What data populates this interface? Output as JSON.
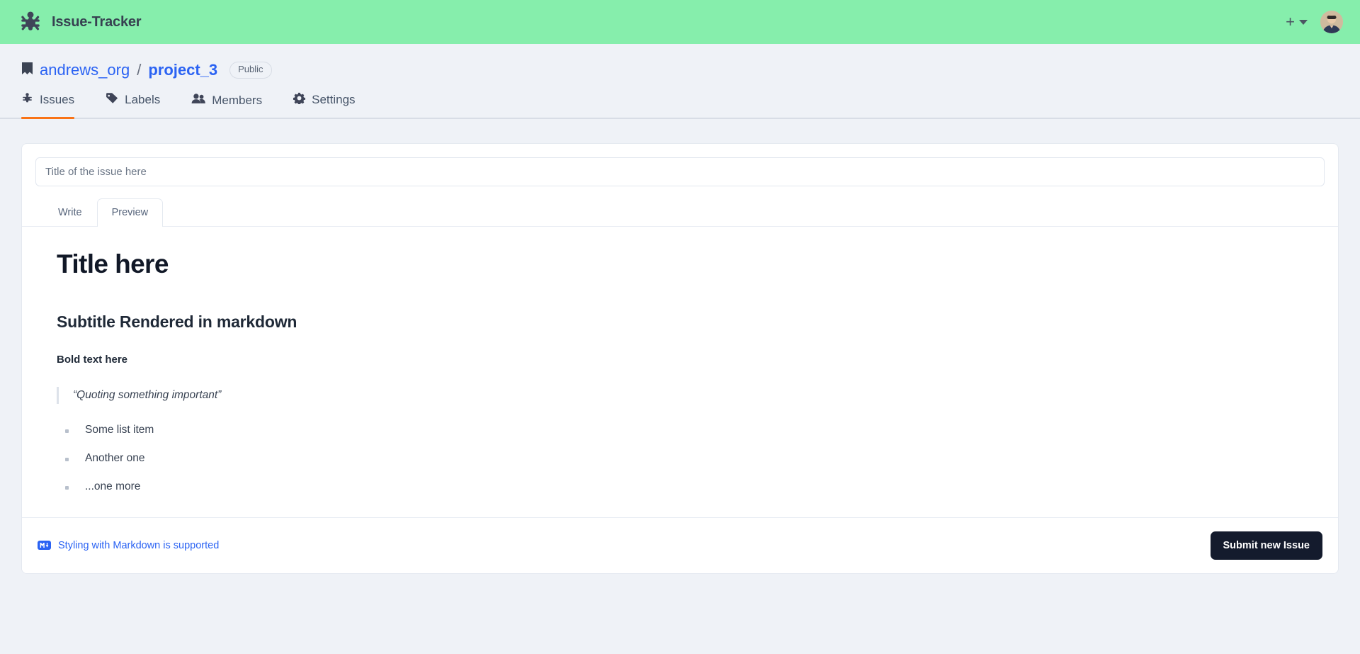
{
  "app": {
    "name": "Issue-Tracker",
    "logo_icon": "bug-icon",
    "header_color": "#86eeac",
    "accent_color": "#f97316",
    "link_color": "#2b63f3"
  },
  "topbar": {
    "create_icon": "plus-icon",
    "create_caret_icon": "chevron-down-icon",
    "avatar_icon": "user-avatar"
  },
  "breadcrumb": {
    "repo_icon": "book-icon",
    "owner": "andrews_org",
    "separator": "/",
    "project": "project_3",
    "visibility": "Public"
  },
  "nav": {
    "items": [
      {
        "label": "Issues",
        "icon": "bug-icon",
        "active": true
      },
      {
        "label": "Labels",
        "icon": "tag-icon",
        "active": false
      },
      {
        "label": "Members",
        "icon": "people-icon",
        "active": false
      },
      {
        "label": "Settings",
        "icon": "gear-icon",
        "active": false
      }
    ]
  },
  "issue_form": {
    "title_placeholder": "Title of the issue here",
    "title_value": "",
    "editor_tabs": [
      {
        "label": "Write",
        "active": false
      },
      {
        "label": "Preview",
        "active": true
      }
    ],
    "preview": {
      "heading1": "Title here",
      "heading2": "Subtitle Rendered in markdown",
      "bold_text": "Bold text here",
      "blockquote": "“Quoting something important”",
      "list_items": [
        "Some list item",
        "Another one",
        "...one more"
      ]
    },
    "footer": {
      "markdown_icon": "markdown-icon",
      "markdown_help": "Styling with Markdown is supported",
      "submit_label": "Submit new Issue"
    }
  }
}
